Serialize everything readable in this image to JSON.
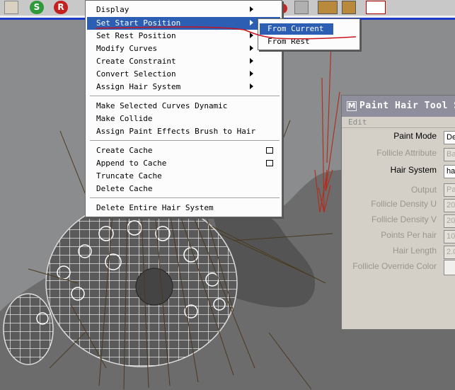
{
  "shelf": {
    "icons": [
      "hair-brush-icon",
      "s-icon",
      "r-icon",
      "tool-icon",
      "arrows-icon",
      "box-icon",
      "film-icon"
    ],
    "s_glyph": "S",
    "r_glyph": "R",
    "colors": {
      "s": "#2f9a3a",
      "r": "#c52020",
      "accent_line": "#1a3cc8"
    }
  },
  "menu": {
    "items": [
      {
        "label": "Display",
        "submenu": true
      },
      {
        "label": "Set Start Position",
        "submenu": true,
        "highlighted": true
      },
      {
        "label": "Set Rest Position",
        "submenu": true
      },
      {
        "label": "Modify Curves",
        "submenu": true
      },
      {
        "label": "Create Constraint",
        "submenu": true
      },
      {
        "label": "Convert Selection",
        "submenu": true
      },
      {
        "label": "Assign Hair System",
        "submenu": true
      },
      {
        "label": "Make Selected Curves Dynamic"
      },
      {
        "label": "Make Collide"
      },
      {
        "label": "Assign Paint Effects Brush to Hair"
      },
      {
        "label": "Create Cache",
        "option_box": true
      },
      {
        "label": "Append to Cache",
        "option_box": true
      },
      {
        "label": "Truncate Cache"
      },
      {
        "label": "Delete Cache"
      },
      {
        "label": "Delete Entire Hair System"
      }
    ],
    "highlight_color": "#2c5fb4"
  },
  "submenu": {
    "items": [
      {
        "label": "From Current",
        "highlighted": true
      },
      {
        "label": "From Rest"
      }
    ]
  },
  "panel": {
    "title": "Paint Hair Tool S",
    "title_icon_glyph": "M",
    "menu": "Edit",
    "fields": [
      {
        "label": "Paint Mode",
        "value": "De",
        "enabled": true
      },
      {
        "label": "Follicle Attribute",
        "value": "Ba",
        "enabled": false
      },
      {
        "label": "Hair System",
        "value": "ha",
        "enabled": true
      },
      {
        "label": "Output",
        "value": "Pa",
        "enabled": false
      },
      {
        "label": "Follicle Density U",
        "value": "20",
        "enabled": false
      },
      {
        "label": "Follicle Density V",
        "value": "20",
        "enabled": false
      },
      {
        "label": "Points Per hair",
        "value": "10",
        "enabled": false
      },
      {
        "label": "Hair Length",
        "value": "2.0",
        "enabled": false
      },
      {
        "label": "Follicle Override Color",
        "value": "",
        "enabled": false
      }
    ]
  }
}
